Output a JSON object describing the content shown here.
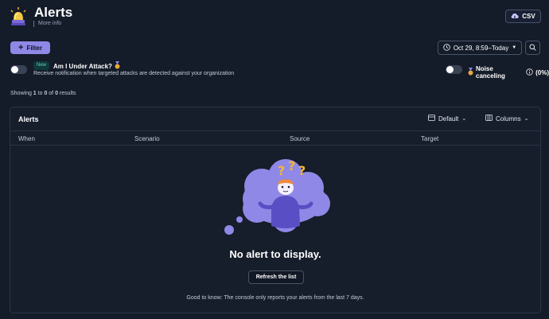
{
  "header": {
    "title": "Alerts",
    "more_info": "More info",
    "csv_label": "CSV"
  },
  "toolbar": {
    "filter_label": "Filter",
    "date_range": "Oct 29, 8:59–Today"
  },
  "attack": {
    "badge": "New",
    "title": "Am I Under Attack?",
    "description": "Receive notification when targeted attacks are detected against your organization"
  },
  "noise": {
    "label": "Noise canceling",
    "value": "(0%)"
  },
  "results": {
    "prefix": "Showing ",
    "from": "1",
    "to_word": " to ",
    "to": "0",
    "of_word": " of ",
    "total": "0",
    "suffix": " results"
  },
  "panel": {
    "title": "Alerts",
    "view_label": "Default",
    "columns_label": "Columns",
    "columns": [
      "When",
      "Scenario",
      "Source",
      "Target"
    ],
    "empty_title": "No alert to display.",
    "refresh_label": "Refresh the list",
    "good_to_know": "Good to know: The console only reports your alerts from the last 7 days."
  },
  "colors": {
    "background": "#141b29",
    "accent": "#8f88e6",
    "badge_text": "#58d6c7"
  }
}
